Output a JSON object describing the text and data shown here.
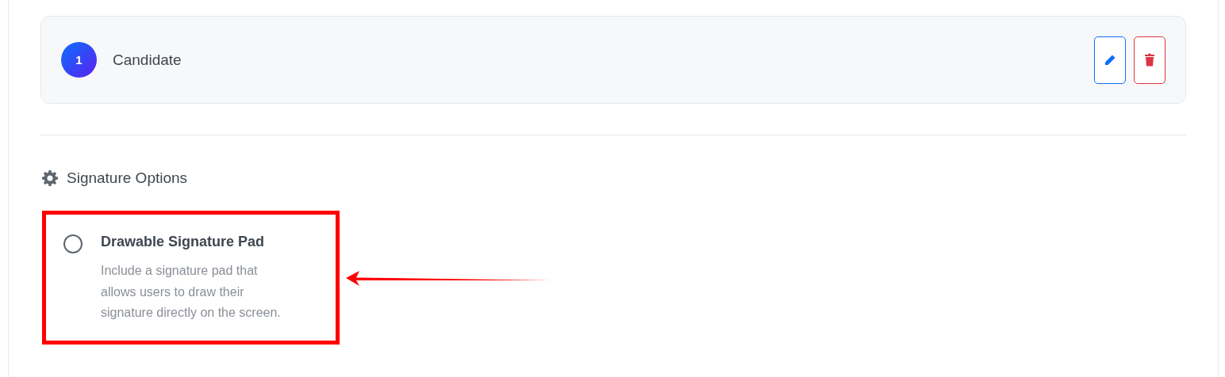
{
  "steps": [
    {
      "number": "1",
      "title": "Candidate"
    }
  ],
  "section": {
    "title": "Signature Options"
  },
  "options": [
    {
      "title": "Drawable Signature Pad",
      "description": "Include a signature pad that allows users to draw their signature directly on the screen.",
      "selected": false,
      "highlighted": true
    }
  ]
}
